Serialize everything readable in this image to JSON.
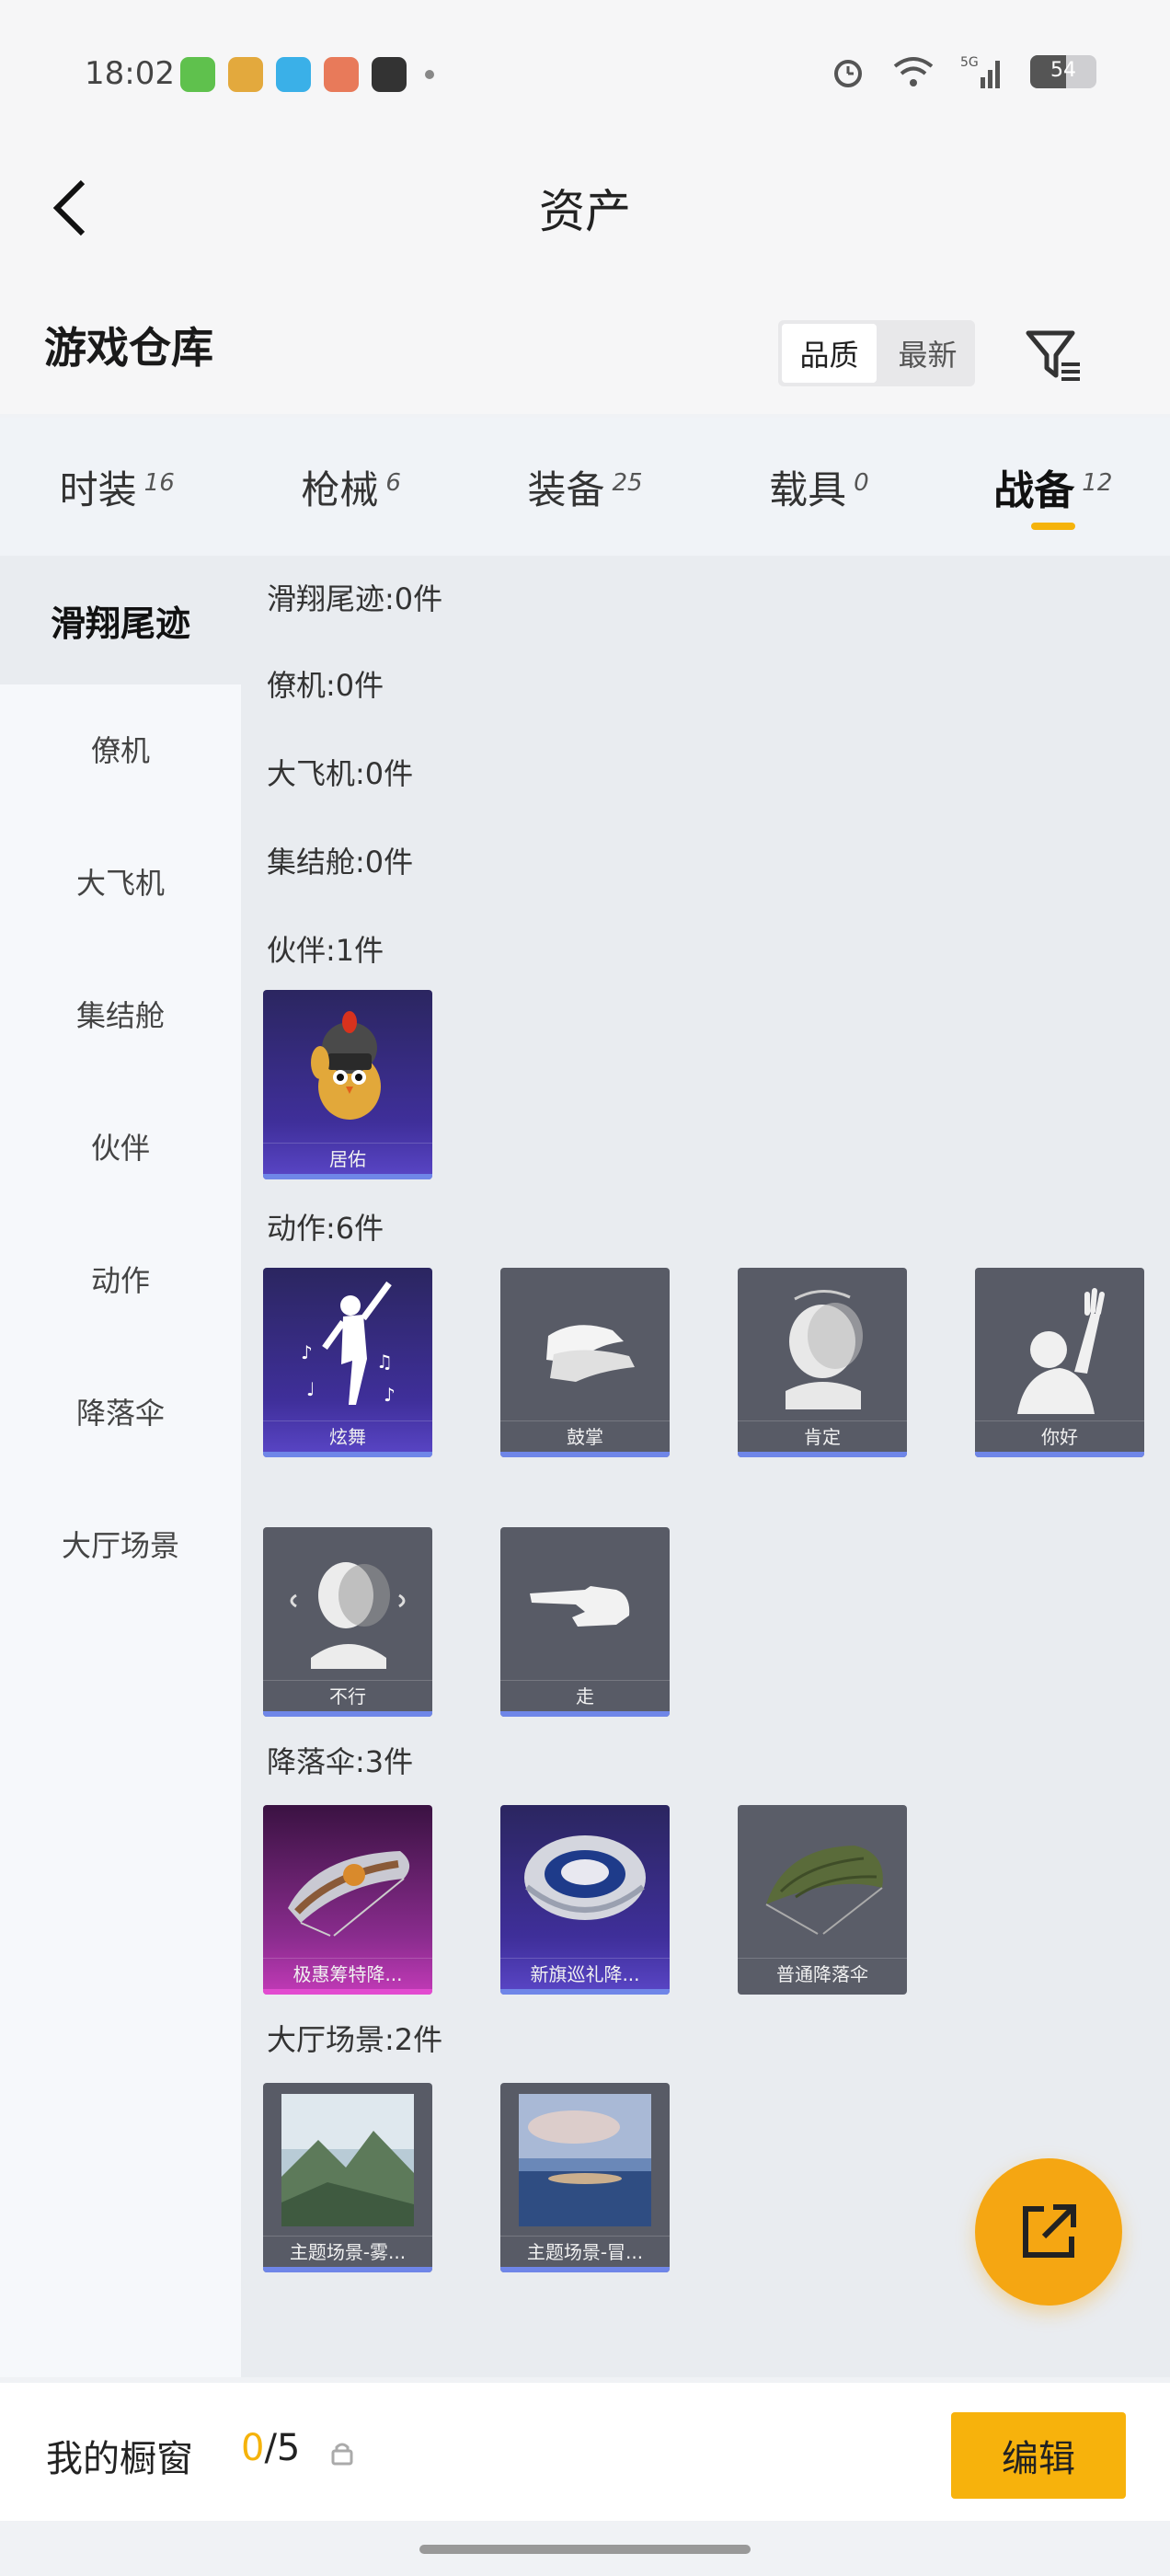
{
  "status_bar": {
    "time": "18:02",
    "battery": "54",
    "battery_level": 0.54,
    "icons": [
      "wechat-icon",
      "app-icon",
      "video-app-icon",
      "game-app-icon",
      "camera-app-icon",
      "alarm-icon",
      "wifi-icon",
      "signal-5g-icon",
      "battery-icon"
    ]
  },
  "nav": {
    "title": "资产"
  },
  "header": {
    "title": "游戏仓库",
    "sort_options": [
      "品质",
      "最新"
    ],
    "sort_active": 0
  },
  "tabs": [
    {
      "label": "时装",
      "count": "16"
    },
    {
      "label": "枪械",
      "count": "6"
    },
    {
      "label": "装备",
      "count": "25"
    },
    {
      "label": "载具",
      "count": "0"
    },
    {
      "label": "战备",
      "count": "12"
    }
  ],
  "active_tab": 4,
  "sidebar": [
    {
      "label": "滑翔尾迹"
    },
    {
      "label": "僚机"
    },
    {
      "label": "大飞机"
    },
    {
      "label": "集结舱"
    },
    {
      "label": "伙伴"
    },
    {
      "label": "动作"
    },
    {
      "label": "降落伞"
    },
    {
      "label": "大厅场景"
    }
  ],
  "groups": [
    {
      "title": "滑翔尾迹:0件",
      "items": []
    },
    {
      "title": "僚机:0件",
      "items": []
    },
    {
      "title": "大飞机:0件",
      "items": []
    },
    {
      "title": "集结舱:0件",
      "items": []
    },
    {
      "title": "伙伴:1件",
      "items": [
        {
          "name": "居佑",
          "icon": "chick-partner-icon"
        }
      ]
    },
    {
      "title": "动作:6件",
      "items": [
        {
          "name": "炫舞",
          "icon": "dance-icon"
        },
        {
          "name": "鼓掌",
          "icon": "clap-icon"
        },
        {
          "name": "肯定",
          "icon": "nod-icon"
        },
        {
          "name": "你好",
          "icon": "wave-hand-icon"
        },
        {
          "name": "不行",
          "icon": "shake-head-icon"
        },
        {
          "name": "走",
          "icon": "point-icon"
        }
      ]
    },
    {
      "title": "降落伞:3件",
      "items": [
        {
          "name": "极惠筹特降...",
          "icon": "parachute-icon"
        },
        {
          "name": "新旗巡礼降...",
          "icon": "parachute-icon"
        },
        {
          "name": "普通降落伞",
          "icon": "parachute-icon"
        }
      ]
    },
    {
      "title": "大厅场景:2件",
      "items": [
        {
          "name": "主题场景-雾...",
          "icon": "landscape-icon"
        },
        {
          "name": "主题场景-冒...",
          "icon": "seascape-icon"
        }
      ]
    }
  ],
  "bottom": {
    "showcase_label": "我的橱窗",
    "showcase_current": "0",
    "showcase_total": "/5",
    "edit_label": "编辑"
  }
}
